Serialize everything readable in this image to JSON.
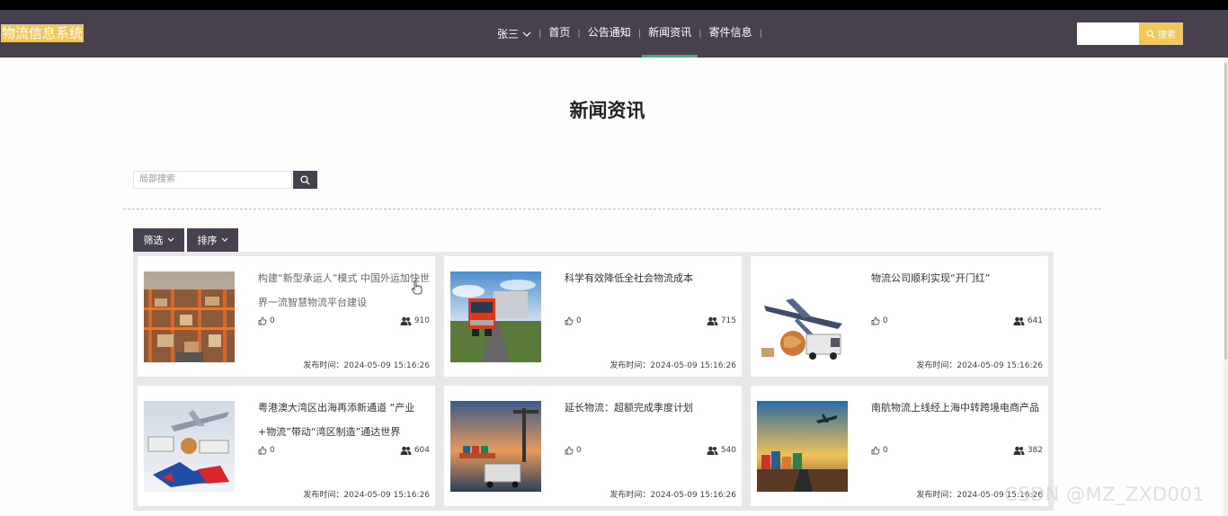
{
  "header": {
    "logo": "物流信息系统",
    "user": "张三",
    "nav": [
      "首页",
      "公告通知",
      "新闻资讯",
      "寄件信息"
    ],
    "active_index": 2,
    "search_placeholder": "",
    "search_button": "搜索"
  },
  "page": {
    "title": "新闻资讯",
    "local_search_placeholder": "局部搜索",
    "filter_label": "筛选",
    "sort_label": "排序"
  },
  "news": [
    {
      "title": "构建“新型承运人”模式 中国外运加快世界一流智慧物流平台建设",
      "likes": "0",
      "views": "910",
      "time": "发布时间：2024-05-09 15:16:26"
    },
    {
      "title": "科学有效降低全社会物流成本",
      "likes": "0",
      "views": "715",
      "time": "发布时间：2024-05-09 15:16:26"
    },
    {
      "title": "物流公司顺利实现“开门红”",
      "likes": "0",
      "views": "641",
      "time": "发布时间：2024-05-09 15:16:26"
    },
    {
      "title": "粤港澳大湾区出海再添新通道 “产业+物流”带动“湾区制造”通达世界",
      "likes": "0",
      "views": "604",
      "time": "发布时间：2024-05-09 15:16:26"
    },
    {
      "title": "延长物流：超额完成季度计划",
      "likes": "0",
      "views": "540",
      "time": "发布时间：2024-05-09 15:16:26"
    },
    {
      "title": "南航物流上线经上海中转跨境电商产品",
      "likes": "0",
      "views": "382",
      "time": "发布时间：2024-05-09 15:16:26"
    }
  ],
  "watermark": "CSDN @MZ_ZXD001",
  "colors": {
    "nav_bg": "#47404f",
    "accent": "#f2c75a",
    "active_underline": "#36b58e"
  }
}
